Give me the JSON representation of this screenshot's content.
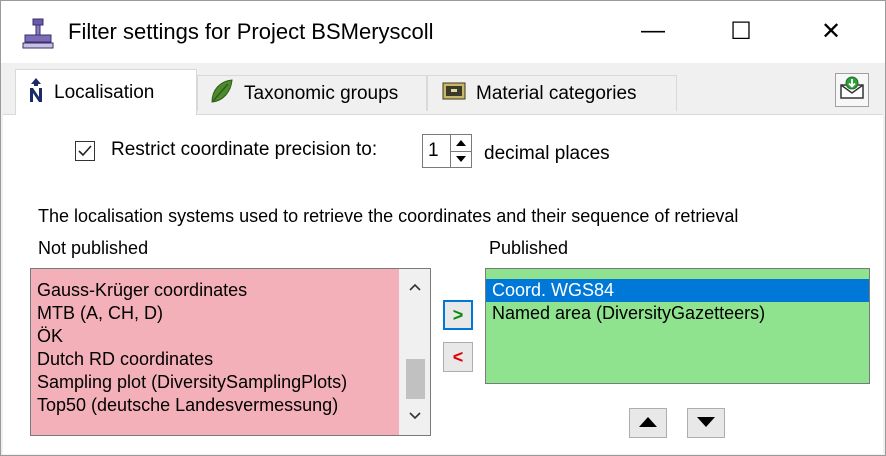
{
  "window": {
    "title": "Filter settings for Project BSMeryscoll",
    "minimize_glyph": "—",
    "maximize_glyph": "☐",
    "close_glyph": "✕"
  },
  "tabs": [
    {
      "label": "Localisation",
      "icon": "north-arrow-icon",
      "active": true
    },
    {
      "label": "Taxonomic groups",
      "icon": "leaf-icon",
      "active": false
    },
    {
      "label": "Material categories",
      "icon": "cabinet-icon",
      "active": false
    }
  ],
  "toolbar": {
    "mail_icon": "mail-download-icon"
  },
  "precision": {
    "checked": true,
    "label": "Restrict coordinate precision to:",
    "value": "1",
    "suffix": "decimal places"
  },
  "description": "The localisation systems used to retrieve the coordinates and their sequence of retrieval",
  "not_published": {
    "header": "Not published",
    "items": [
      "Gauss-Krüger coordinates",
      "MTB (A, CH, D)",
      "ÖK",
      "Dutch RD coordinates",
      "Sampling plot (DiversitySamplingPlots)",
      "Top50 (deutsche Landesvermessung)"
    ]
  },
  "published": {
    "header": "Published",
    "items": [
      "Coord. WGS84",
      "Named area (DiversityGazetteers)"
    ],
    "selected_index": 0
  },
  "move_buttons": {
    "to_published": ">",
    "to_not_published": "<"
  },
  "colors": {
    "not_published_bg": "#f3b0b8",
    "published_bg": "#8fe38f",
    "selection": "#0078d7"
  }
}
